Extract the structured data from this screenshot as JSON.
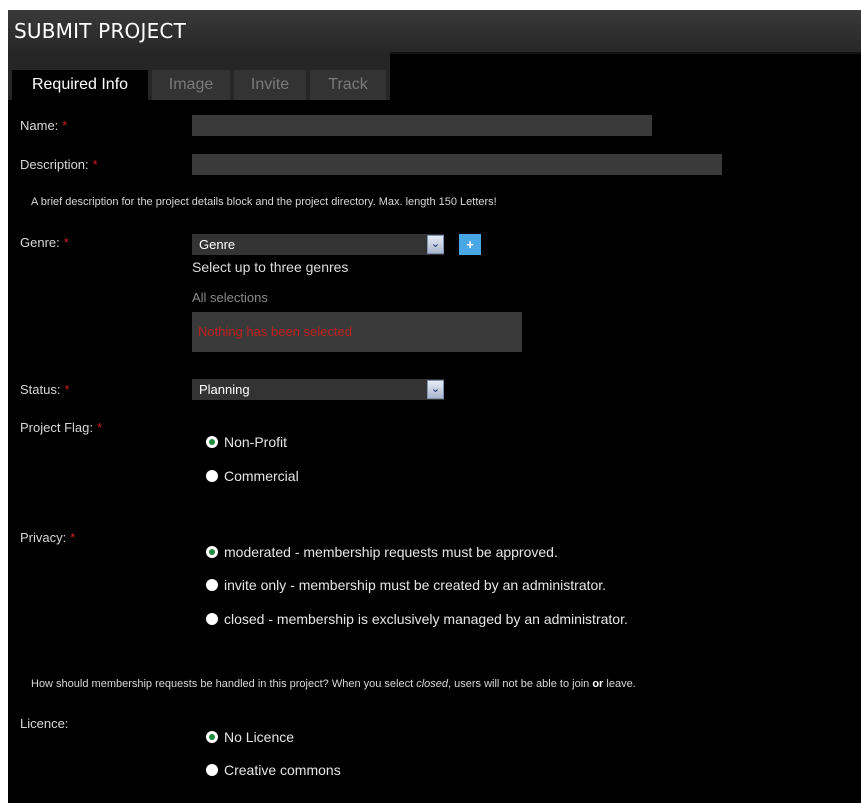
{
  "header": {
    "title": "SUBMIT PROJECT"
  },
  "tabs": [
    {
      "label": "Required Info",
      "active": true
    },
    {
      "label": "Image",
      "active": false
    },
    {
      "label": "Invite",
      "active": false
    },
    {
      "label": "Track",
      "active": false
    }
  ],
  "form": {
    "required_marker": "*",
    "name": {
      "label": "Name:",
      "value": ""
    },
    "description": {
      "label": "Description:",
      "value": "",
      "help": "A brief description for the project details block and the project directory. Max. length 150 Letters!"
    },
    "genre": {
      "label": "Genre:",
      "selected": "Genre",
      "add_label": "+",
      "hint": "Select up to three genres",
      "all_selections_label": "All selections",
      "empty_message": "Nothing has been selected"
    },
    "status": {
      "label": "Status:",
      "selected": "Planning"
    },
    "project_flag": {
      "label": "Project Flag:",
      "options": [
        {
          "label": "Non-Profit",
          "checked": true
        },
        {
          "label": "Commercial",
          "checked": false
        }
      ]
    },
    "privacy": {
      "label": "Privacy:",
      "options": [
        {
          "label": "moderated - membership requests must be approved.",
          "checked": true
        },
        {
          "label": "invite only - membership must be created by an administrator.",
          "checked": false
        },
        {
          "label": "closed - membership is exclusively managed by an administrator.",
          "checked": false
        }
      ],
      "help_before": "How should membership requests be handled in this project? When you select ",
      "help_em": "closed",
      "help_middle": ", users will not be able to join ",
      "help_bold": "or",
      "help_after": " leave."
    },
    "licence": {
      "label": "Licence:",
      "options": [
        {
          "label": "No Licence",
          "checked": true
        },
        {
          "label": "Creative commons",
          "checked": false
        }
      ]
    }
  },
  "colors": {
    "background": "#000000",
    "header": "#2e2e2e",
    "field": "#3a3a3a",
    "required": "#d41e1e",
    "accent_button": "#4aa7e6",
    "radio_checked": "#1f8a3c"
  }
}
